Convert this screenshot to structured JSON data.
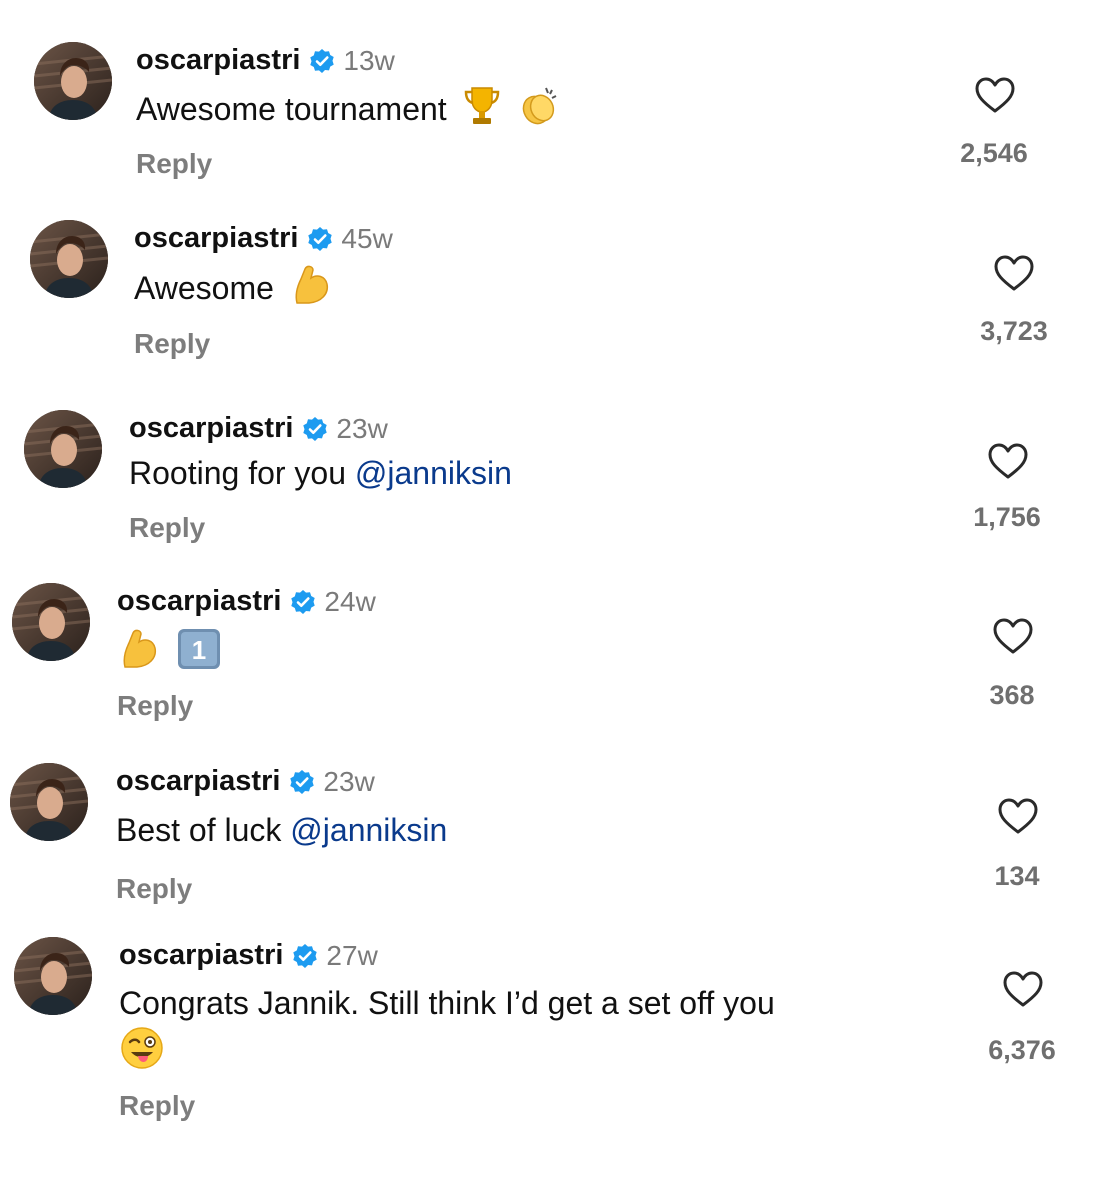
{
  "comments": [
    {
      "username": "oscarpiastri",
      "time": "13w",
      "text": "Awesome tournament",
      "mention": "",
      "emojis": [
        "trophy-icon",
        "clapping-hands-icon"
      ],
      "reply": "Reply",
      "likes": "2,546"
    },
    {
      "username": "oscarpiastri",
      "time": "45w",
      "text": "Awesome",
      "mention": "",
      "emojis": [
        "flexed-biceps-icon"
      ],
      "reply": "Reply",
      "likes": "3,723"
    },
    {
      "username": "oscarpiastri",
      "time": "23w",
      "text": "Rooting for you",
      "mention": "@janniksin",
      "emojis": [],
      "reply": "Reply",
      "likes": "1,756"
    },
    {
      "username": "oscarpiastri",
      "time": "24w",
      "text": "",
      "mention": "",
      "emojis": [
        "flexed-biceps-icon",
        "keycap-1-icon"
      ],
      "reply": "Reply",
      "likes": "368"
    },
    {
      "username": "oscarpiastri",
      "time": "23w",
      "text": "Best of luck",
      "mention": "@janniksin",
      "emojis": [],
      "reply": "Reply",
      "likes": "134"
    },
    {
      "username": "oscarpiastri",
      "time": "27w",
      "text": "Congrats Jannik. Still think I’d get a set off you",
      "mention": "",
      "emojis": [
        "winking-face-tongue-icon"
      ],
      "reply": "Reply",
      "likes": "6,376"
    }
  ],
  "colors": {
    "verified": "#1d9bf0",
    "mention": "#0a3a8c",
    "muted": "#7d7d7d"
  }
}
